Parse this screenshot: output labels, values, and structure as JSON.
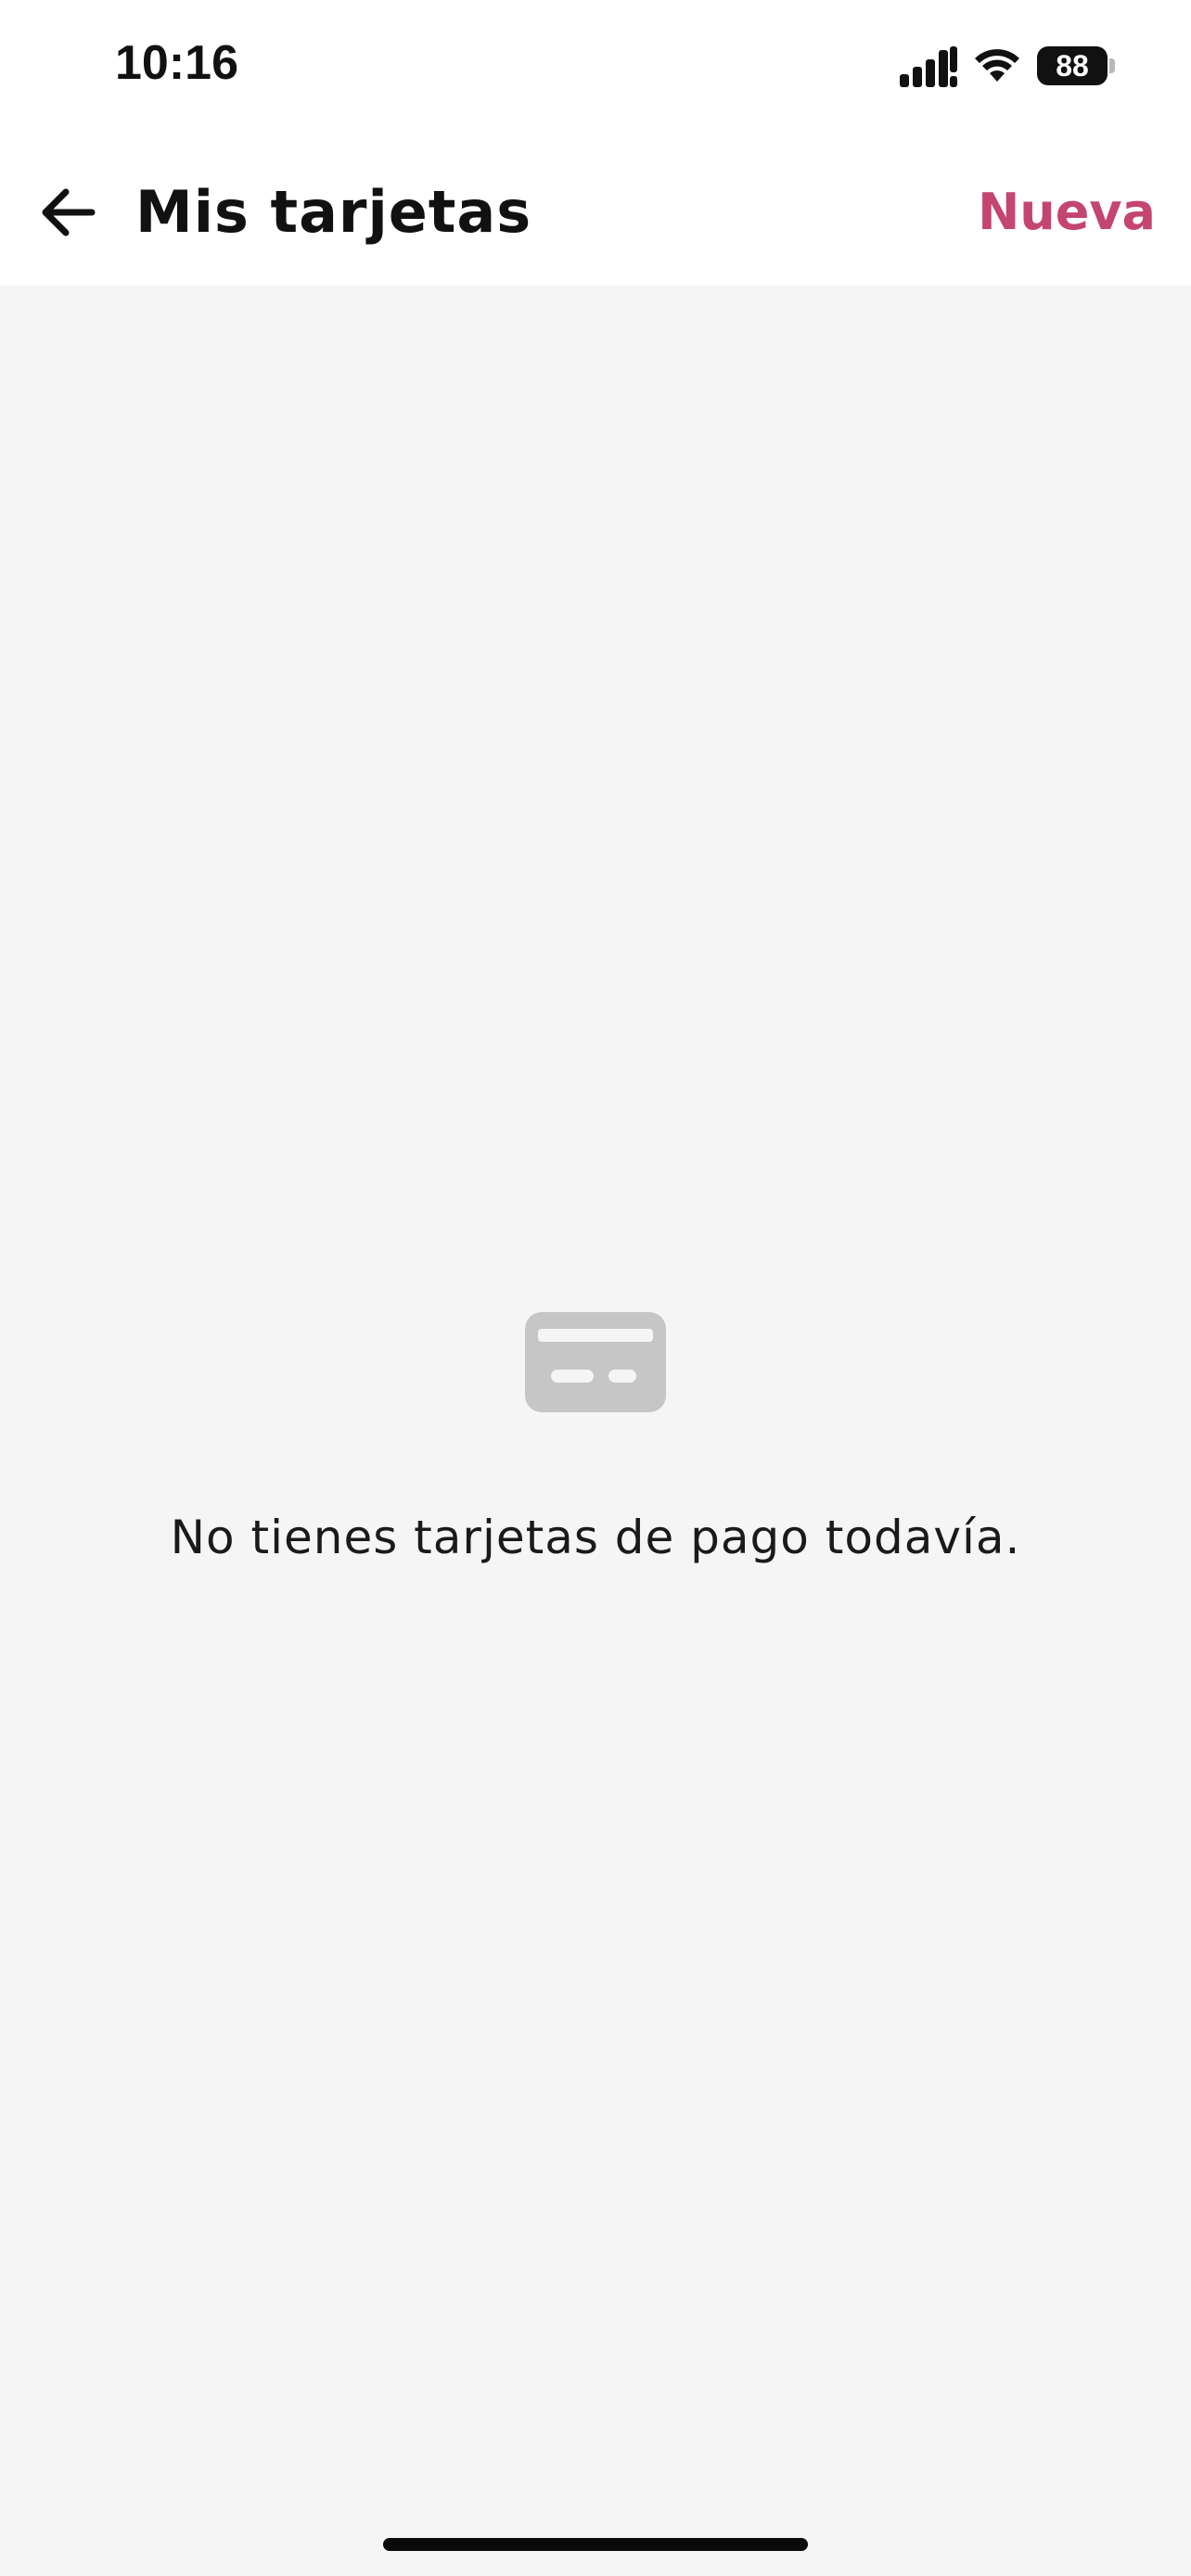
{
  "status_bar": {
    "time": "10:16",
    "battery_level": "88",
    "icons": [
      "signal-icon",
      "wifi-icon",
      "battery-icon"
    ]
  },
  "header": {
    "title": "Mis tarjetas",
    "new_label": "Nueva",
    "back_icon": "arrow-left-icon"
  },
  "empty_state": {
    "icon": "credit-card-icon",
    "message": "No tienes tarjetas de pago todavía."
  },
  "colors": {
    "accent": "#c4456f",
    "background": "#f5f5f5",
    "header_background": "#ffffff",
    "icon_muted": "#c6c6c6",
    "text_primary": "#111111"
  }
}
